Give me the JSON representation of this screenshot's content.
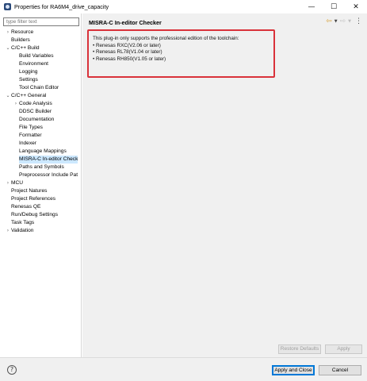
{
  "window": {
    "title": "Properties for RA6M4_drive_capacity",
    "minimize": "—",
    "maximize": "☐",
    "close": "✕"
  },
  "sidebar": {
    "filter_placeholder": "type filter text",
    "items": [
      {
        "label": "Resource",
        "level": 0,
        "expander": "›"
      },
      {
        "label": "Builders",
        "level": 0,
        "expander": ""
      },
      {
        "label": "C/C++ Build",
        "level": 0,
        "expander": "⌄"
      },
      {
        "label": "Build Variables",
        "level": 1,
        "expander": ""
      },
      {
        "label": "Environment",
        "level": 1,
        "expander": ""
      },
      {
        "label": "Logging",
        "level": 1,
        "expander": ""
      },
      {
        "label": "Settings",
        "level": 1,
        "expander": ""
      },
      {
        "label": "Tool Chain Editor",
        "level": 1,
        "expander": ""
      },
      {
        "label": "C/C++ General",
        "level": 0,
        "expander": "⌄"
      },
      {
        "label": "Code Analysis",
        "level": 1,
        "expander": "›"
      },
      {
        "label": "DDSC Builder",
        "level": 1,
        "expander": ""
      },
      {
        "label": "Documentation",
        "level": 1,
        "expander": ""
      },
      {
        "label": "File Types",
        "level": 1,
        "expander": ""
      },
      {
        "label": "Formatter",
        "level": 1,
        "expander": ""
      },
      {
        "label": "Indexer",
        "level": 1,
        "expander": ""
      },
      {
        "label": "Language Mappings",
        "level": 1,
        "expander": ""
      },
      {
        "label": "MISRA-C In-editor Check",
        "level": 1,
        "expander": "",
        "selected": true
      },
      {
        "label": "Paths and Symbols",
        "level": 1,
        "expander": ""
      },
      {
        "label": "Preprocessor Include Pat",
        "level": 1,
        "expander": ""
      },
      {
        "label": "MCU",
        "level": 0,
        "expander": "›"
      },
      {
        "label": "Project Natures",
        "level": 0,
        "expander": ""
      },
      {
        "label": "Project References",
        "level": 0,
        "expander": ""
      },
      {
        "label": "Renesas QE",
        "level": 0,
        "expander": ""
      },
      {
        "label": "Run/Debug Settings",
        "level": 0,
        "expander": ""
      },
      {
        "label": "Task Tags",
        "level": 0,
        "expander": ""
      },
      {
        "label": "Validation",
        "level": 0,
        "expander": "›"
      }
    ]
  },
  "page": {
    "title": "MISRA-C In-editor Checker",
    "nav": {
      "back": "⇦",
      "forward": "⇨",
      "dropdown": "▼",
      "menu": "⋮"
    },
    "info": [
      "This plug-in only supports the professional edition of the toolchain:",
      "• Renesas RXC(V2.06 or later)",
      "• Renesas RL78(V1.04 or later)",
      "• Renesas RH850(V1.05 or later)"
    ],
    "restore_defaults": "Restore Defaults",
    "apply": "Apply"
  },
  "footer": {
    "help": "?",
    "apply_and_close": "Apply and Close",
    "cancel": "Cancel"
  },
  "colors": {
    "highlight_border": "#d9323a",
    "selection": "#cce8ff",
    "default_button_border": "#0078d7"
  }
}
